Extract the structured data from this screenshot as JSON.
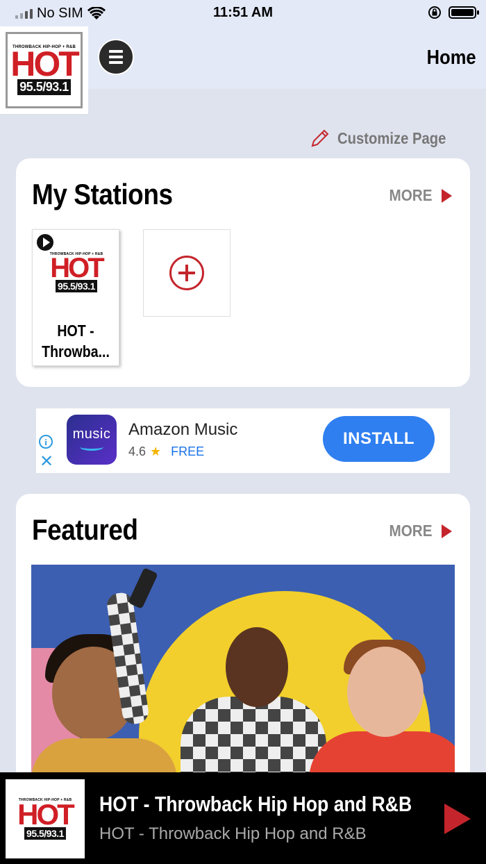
{
  "status_bar": {
    "carrier": "No SIM",
    "time": "11:51 AM"
  },
  "header": {
    "title": "Home",
    "logo": {
      "tagline": "THROWBACK HIP-HOP + R&B",
      "wordmark": "HOT",
      "frequencies": "95.5/93.1"
    }
  },
  "customize_label": "Customize Page",
  "my_stations": {
    "title": "My Stations",
    "more_label": "MORE",
    "stations": [
      {
        "name_line1": "HOT -",
        "name_line2": "Throwba..."
      }
    ]
  },
  "ad": {
    "app_name": "Amazon Music",
    "icon_text": "music",
    "rating": "4.6",
    "price": "FREE",
    "install_label": "INSTALL"
  },
  "featured": {
    "title": "Featured",
    "more_label": "MORE"
  },
  "now_playing": {
    "title": "HOT - Throwback Hip Hop and R&B",
    "subtitle": "HOT - Throwback Hip Hop and R&B"
  },
  "colors": {
    "accent_red": "#c4252c",
    "install_blue": "#2f7ff0",
    "background": "#dfe3ee"
  }
}
